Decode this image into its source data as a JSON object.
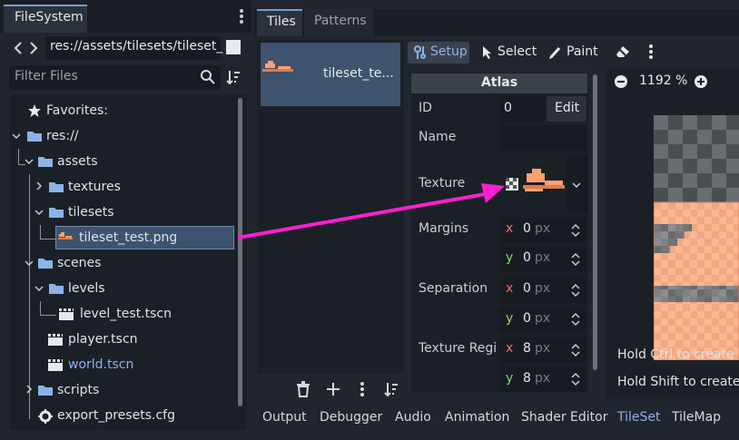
{
  "filesystem": {
    "tab_label": "FileSystem",
    "path": "res://assets/tilesets/tileset_",
    "filter_placeholder": "Filter Files",
    "tree": {
      "favorites": "Favorites:",
      "res": "res://",
      "assets": "assets",
      "textures": "textures",
      "tilesets": "tilesets",
      "tileset_png": "tileset_test.png",
      "scenes": "scenes",
      "levels": "levels",
      "level_test": "level_test.tscn",
      "player": "player.tscn",
      "world": "world.tscn",
      "scripts": "scripts",
      "export_presets": "export_presets.cfg"
    }
  },
  "tileset_panel": {
    "tabs": [
      "Tiles",
      "Patterns"
    ],
    "tile_item_name": "tileset_te...",
    "toolbar": {
      "setup": "Setup",
      "select": "Select",
      "paint": "Paint"
    },
    "inspector": {
      "header": "Atlas",
      "id_label": "ID",
      "id_value": "0",
      "edit_label": "Edit",
      "name_label": "Name",
      "texture_label": "Texture",
      "margins_label": "Margins",
      "margins": {
        "x": "0",
        "y": "0"
      },
      "separation_label": "Separation",
      "separation": {
        "x": "0",
        "y": "0"
      },
      "region_label": "Texture Regi",
      "region": {
        "x": "8",
        "y": "8"
      },
      "unit": "px",
      "axis_x": "x",
      "axis_y": "y"
    },
    "viewport": {
      "zoom": "1192 %",
      "hint1": "Hold Ctrl to create m",
      "hint2": "Hold Shift to create b"
    }
  },
  "bottom_tabs": [
    "Output",
    "Debugger",
    "Audio",
    "Animation",
    "Shader Editor",
    "TileSet",
    "TileMap"
  ],
  "colors": {
    "accent": "#6f9fd9",
    "selection": "#3e536e",
    "arrow": "#ff1fd0",
    "tile_orange": "#ffa070",
    "axis_x": "#e8706a",
    "axis_y": "#8fd46a",
    "link_blue": "#8ab4e8"
  }
}
